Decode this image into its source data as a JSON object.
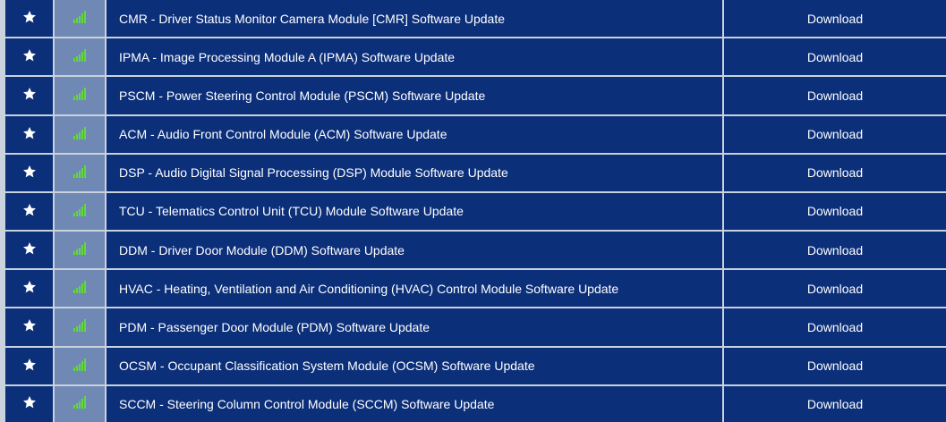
{
  "download_label": "Download",
  "rows": [
    {
      "title": "CMR - Driver Status Monitor Camera Module [CMR] Software Update"
    },
    {
      "title": "IPMA - Image Processing Module A (IPMA) Software Update"
    },
    {
      "title": "PSCM - Power Steering Control Module (PSCM) Software Update"
    },
    {
      "title": "ACM - Audio Front Control Module (ACM) Software Update"
    },
    {
      "title": "DSP - Audio Digital Signal Processing (DSP) Module Software Update"
    },
    {
      "title": "TCU - Telematics Control Unit (TCU) Module Software Update"
    },
    {
      "title": "DDM - Driver Door Module (DDM) Software Update"
    },
    {
      "title": "HVAC - Heating, Ventilation and Air Conditioning (HVAC) Control Module Software Update"
    },
    {
      "title": "PDM - Passenger Door Module (PDM) Software Update"
    },
    {
      "title": "OCSM - Occupant Classification System Module (OCSM) Software Update"
    },
    {
      "title": "SCCM - Steering Column Control Module (SCCM) Software Update"
    }
  ],
  "icons": {
    "favorite": "star-icon",
    "signal": "signal-bars-icon"
  },
  "colors": {
    "row_background": "#0c2f7a",
    "signal_cell": "#6f88b4",
    "signal_bars": "#62d93b",
    "text": "#ffffff",
    "grid": "#c9d2dd"
  }
}
